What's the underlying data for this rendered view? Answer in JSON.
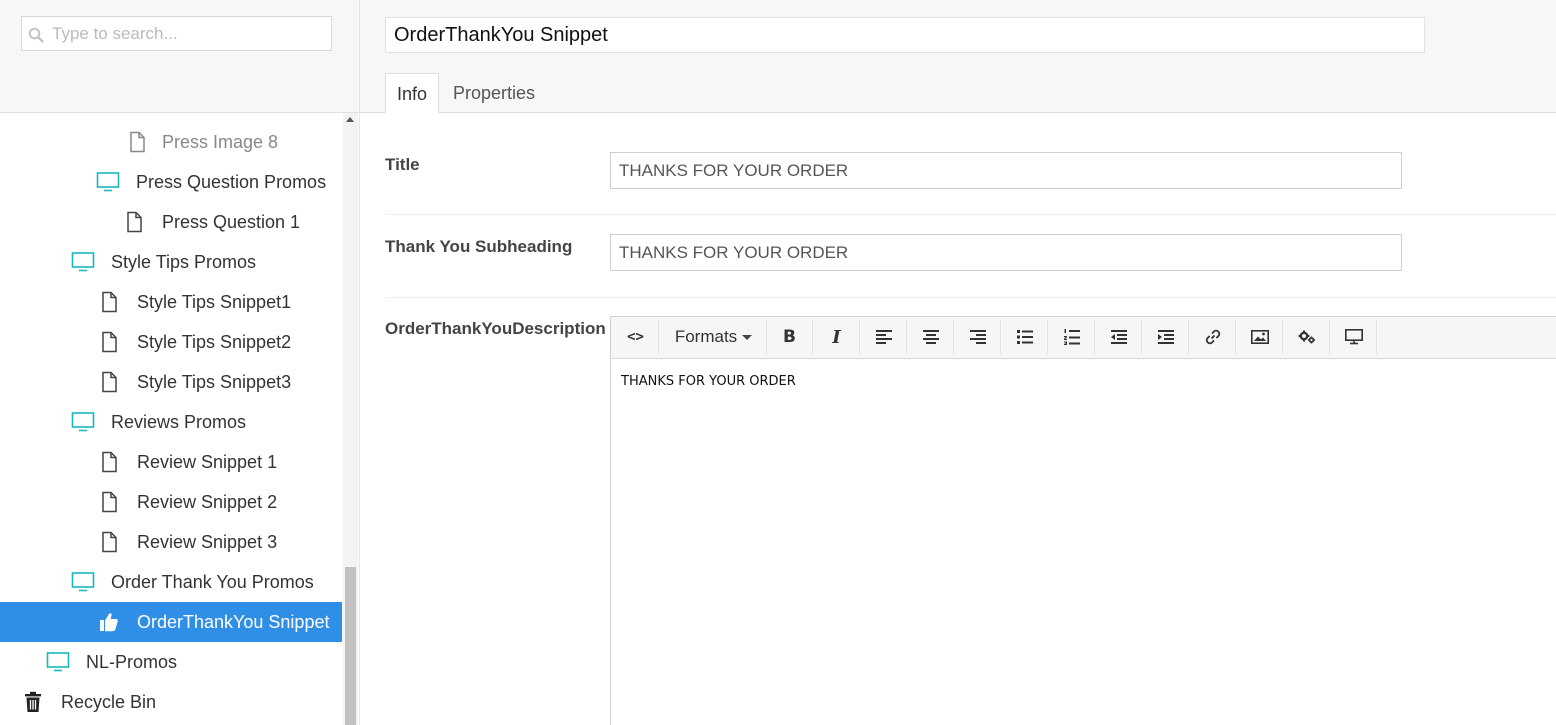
{
  "search": {
    "placeholder": "Type to search..."
  },
  "tree": {
    "items": [
      {
        "label": "Press Image 8",
        "icon": "document-icon"
      },
      {
        "label": "Press Question Promos",
        "icon": "monitor-icon"
      },
      {
        "label": "Press Question 1",
        "icon": "document-icon"
      },
      {
        "label": "Style Tips Promos",
        "icon": "monitor-icon"
      },
      {
        "label": "Style Tips Snippet1",
        "icon": "document-icon"
      },
      {
        "label": "Style Tips Snippet2",
        "icon": "document-icon"
      },
      {
        "label": "Style Tips Snippet3",
        "icon": "document-icon"
      },
      {
        "label": "Reviews Promos",
        "icon": "monitor-icon"
      },
      {
        "label": "Review Snippet 1",
        "icon": "document-icon"
      },
      {
        "label": "Review Snippet 2",
        "icon": "document-icon"
      },
      {
        "label": "Review Snippet 3",
        "icon": "document-icon"
      },
      {
        "label": "Order Thank You Promos",
        "icon": "monitor-icon"
      },
      {
        "label": "OrderThankYou Snippet",
        "icon": "thumbs-up-icon",
        "selected": true
      },
      {
        "label": "NL-Promos",
        "icon": "monitor-icon"
      },
      {
        "label": "Recycle Bin",
        "icon": "trash-icon"
      }
    ]
  },
  "header": {
    "name": "OrderThankYou Snippet",
    "tabs": [
      {
        "label": "Info",
        "active": true
      },
      {
        "label": "Properties"
      }
    ]
  },
  "fields": {
    "title": {
      "label": "Title",
      "value": "THANKS FOR YOUR ORDER"
    },
    "subheading": {
      "label": "Thank You Subheading",
      "value": "THANKS FOR YOUR ORDER"
    },
    "description": {
      "label": "OrderThankYouDescription"
    }
  },
  "editor": {
    "formats_label": "Formats",
    "bold_glyph": "B",
    "italic_glyph": "I",
    "source_glyph": "<>",
    "content": "THANKS FOR YOUR ORDER"
  },
  "colors": {
    "accent": "#2f8ee6",
    "monitor_icon": "#19b8c0"
  }
}
